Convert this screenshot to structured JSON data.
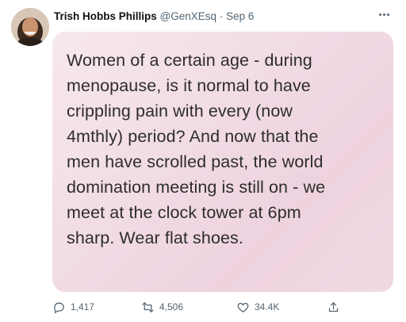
{
  "tweet": {
    "author_name": "Trish Hobbs Phillips",
    "handle": "@GenXEsq",
    "separator": "·",
    "date": "Sep 6",
    "more_icon": "more-horizontal-icon"
  },
  "media": {
    "lines": [
      "Women of a certain age - during",
      "menopause, is it normal to have",
      "crippling pain with every (now",
      "4mthly) period? And now that the",
      "men have scrolled past, the world",
      "domination meeting is still on - we",
      "meet at the clock tower at 6pm",
      "sharp. Wear flat shoes."
    ]
  },
  "actions": {
    "reply_count": "1,417",
    "retweet_count": "4,506",
    "like_count": "34.4K"
  },
  "colors": {
    "text": "#0f1419",
    "muted": "#536471",
    "card_bg": "#f2dde6"
  }
}
